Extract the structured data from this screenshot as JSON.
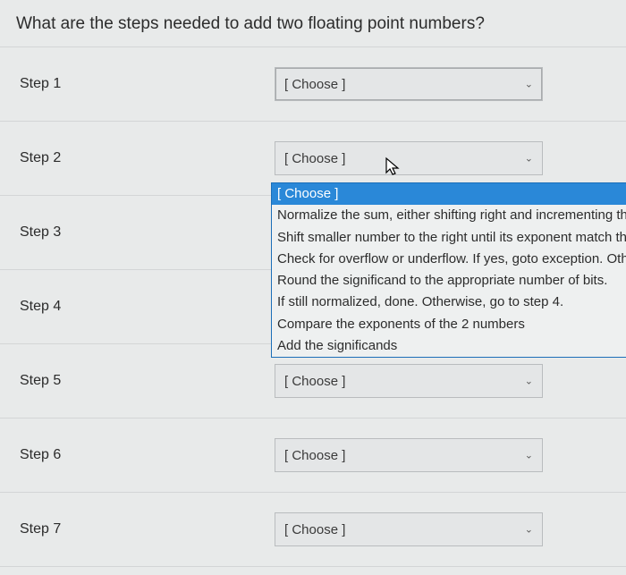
{
  "question": "What are the steps needed to add two floating point numbers?",
  "placeholder": "[ Choose ]",
  "steps": [
    {
      "label": "Step 1"
    },
    {
      "label": "Step 2"
    },
    {
      "label": "Step 3"
    },
    {
      "label": "Step 4"
    },
    {
      "label": "Step 5"
    },
    {
      "label": "Step 6"
    },
    {
      "label": "Step 7"
    }
  ],
  "dropdown": {
    "options": [
      "[ Choose ]",
      "Normalize the sum, either shifting right and incrementing th",
      "Shift smaller number to the right until its exponent match th",
      "Check for overflow or underflow. If yes, goto exception. Oth",
      "Round the significand to the appropriate number of bits.",
      "If still normalized, done. Otherwise, go to step 4.",
      "Compare the exponents of the 2 numbers",
      "Add the significands"
    ],
    "selected_index": 0
  }
}
